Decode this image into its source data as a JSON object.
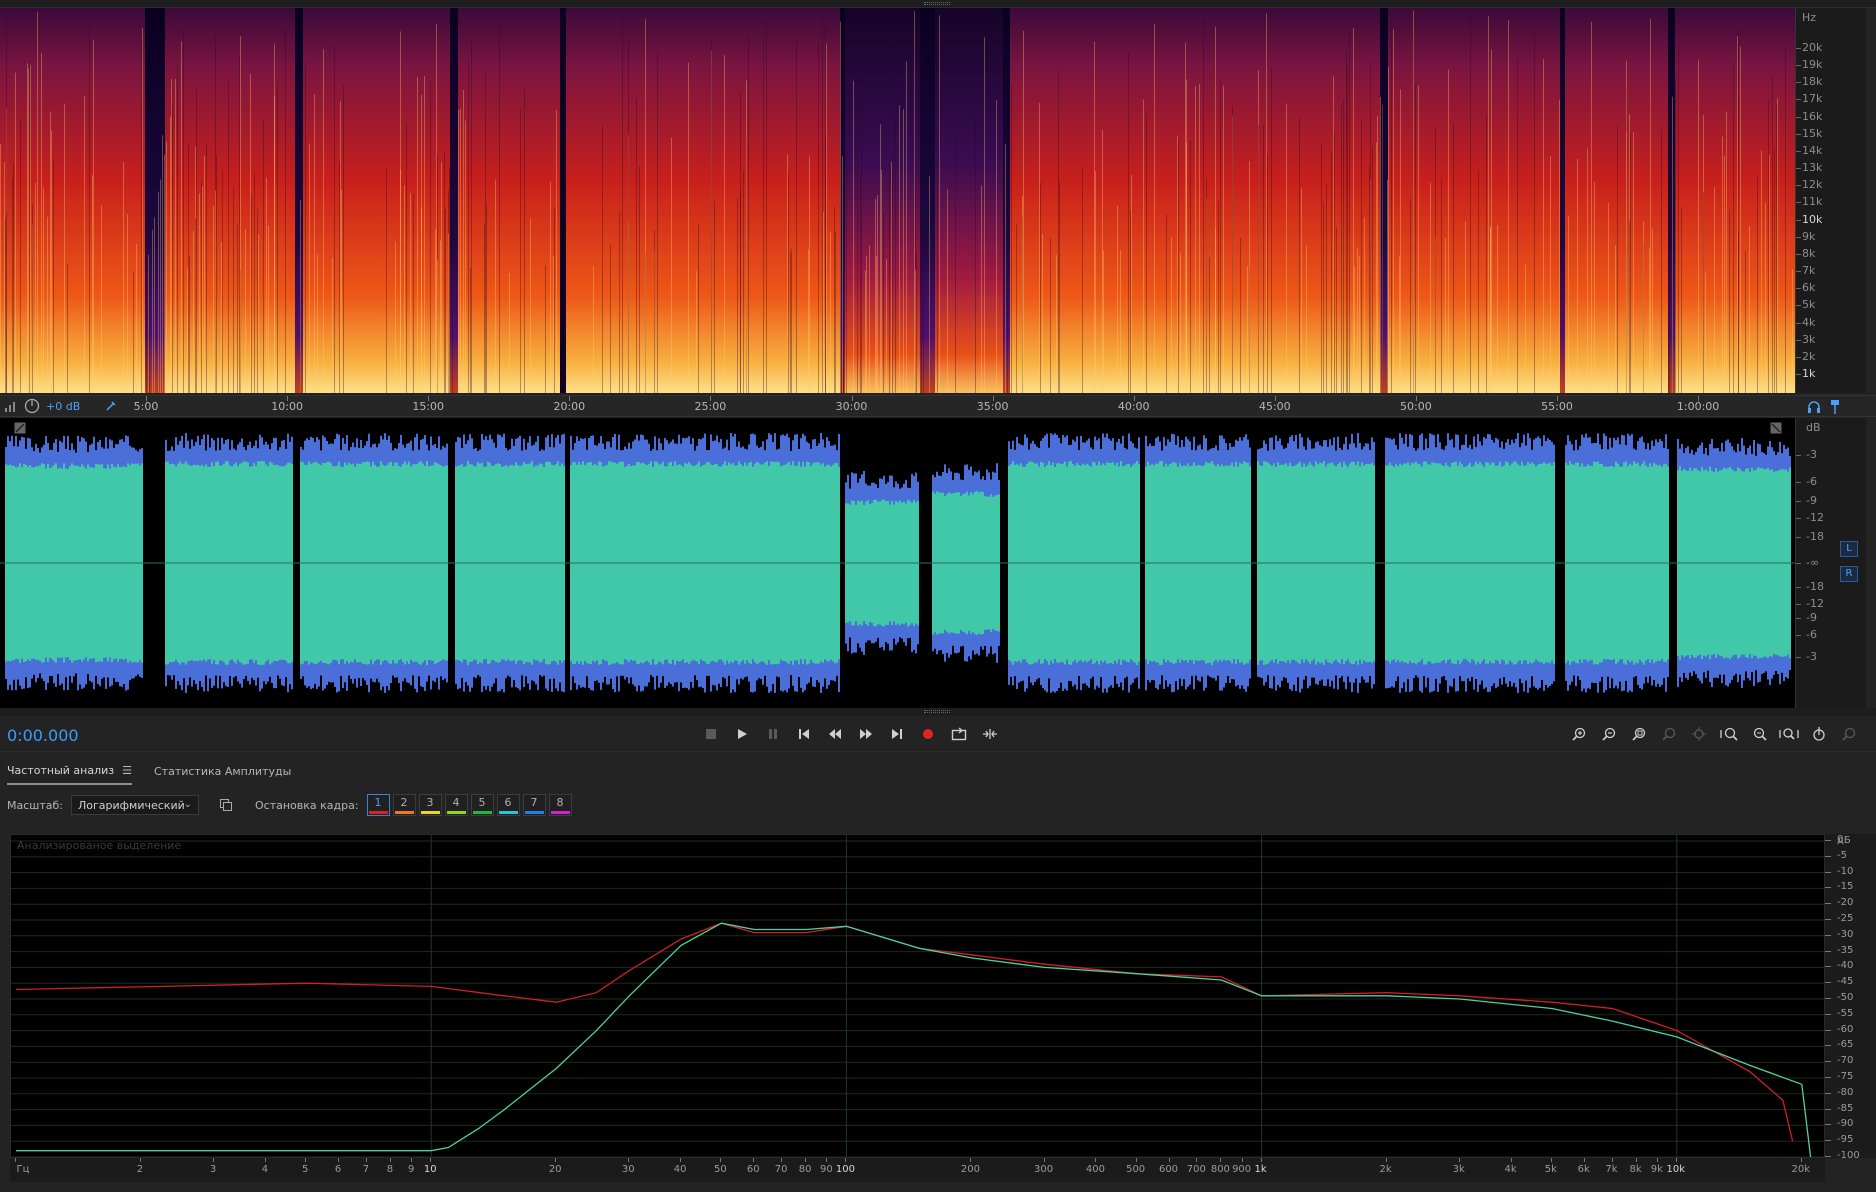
{
  "editor": {
    "spectral": {
      "unit": "Hz",
      "freq_labels": [
        "20k",
        "19k",
        "18k",
        "17k",
        "16k",
        "15k",
        "14k",
        "13k",
        "12k",
        "11k",
        "10k",
        "9k",
        "8k",
        "7k",
        "6k",
        "5k",
        "4k",
        "3k",
        "2k",
        "1k"
      ]
    },
    "timeline": {
      "gain": "+0 dB",
      "labels": [
        "5:00",
        "10:00",
        "15:00",
        "20:00",
        "25:00",
        "30:00",
        "35:00",
        "40:00",
        "45:00",
        "50:00",
        "55:00",
        "1:00:00"
      ]
    },
    "amplitude": {
      "unit": "dB",
      "labels": [
        "-3",
        "-6",
        "-9",
        "-12",
        "-18",
        "-∞",
        "-18",
        "-12",
        "-9",
        "-6",
        "-3"
      ],
      "channel_top": "L",
      "channel_bottom": "R"
    },
    "colors": {
      "waveform": "#40c8a8",
      "waveform_peaks": "#4a6fd8",
      "time_display": "#3d9bff",
      "accent": "#3f7fd0"
    }
  },
  "transport": {
    "time": "0:00.000",
    "buttons": [
      "stop",
      "play",
      "pause",
      "go-to-start",
      "rewind",
      "fast-forward",
      "go-to-end",
      "record",
      "loop",
      "skip-selection"
    ]
  },
  "panel": {
    "tabs": [
      {
        "label": "Частотный анализ",
        "active": true
      },
      {
        "label": "Статистика Амплитуды",
        "active": false
      }
    ],
    "scale_label": "Масштаб:",
    "scale_value": "Логарифмический",
    "freeze_label": "Остановка кадра:",
    "frames": [
      {
        "label": "1",
        "color": "#e02020"
      },
      {
        "label": "2",
        "color": "#f07820"
      },
      {
        "label": "3",
        "color": "#e8d820"
      },
      {
        "label": "4",
        "color": "#90d820"
      },
      {
        "label": "5",
        "color": "#20b840"
      },
      {
        "label": "6",
        "color": "#20c8d8"
      },
      {
        "label": "7",
        "color": "#2080e8"
      },
      {
        "label": "8",
        "color": "#d020d0"
      }
    ],
    "caption": "Анализированое выделение",
    "db_unit": "дБ",
    "db_labels": [
      "0",
      "-5",
      "-10",
      "-15",
      "-20",
      "-25",
      "-30",
      "-35",
      "-40",
      "-45",
      "-50",
      "-55",
      "-60",
      "-65",
      "-70",
      "-75",
      "-80",
      "-85",
      "-90",
      "-95",
      "-100"
    ],
    "freq_labels": [
      "Гц",
      "2",
      "3",
      "4",
      "5",
      "6",
      "7",
      "8",
      "9",
      "10",
      "20",
      "30",
      "40",
      "50",
      "60",
      "70",
      "80",
      "90",
      "100",
      "200",
      "300",
      "400",
      "500",
      "600",
      "700",
      "800",
      "900",
      "1k",
      "2k",
      "3k",
      "4k",
      "5k",
      "6k",
      "7k",
      "8k",
      "9k",
      "10k",
      "20k"
    ]
  },
  "chart_data": {
    "type": "line",
    "title": "",
    "xlabel": "Гц",
    "ylabel": "дБ",
    "x_scale": "log",
    "xlim": [
      1,
      22000
    ],
    "ylim": [
      -100,
      0
    ],
    "series": [
      {
        "color": "#d02020",
        "x": [
          1,
          5,
          10,
          15,
          20,
          25,
          30,
          40,
          50,
          60,
          80,
          100,
          150,
          200,
          300,
          500,
          800,
          1000,
          2000,
          3000,
          5000,
          7000,
          10000,
          15000,
          18000,
          19000
        ],
        "y": [
          -47,
          -45,
          -46,
          -49,
          -51,
          -48,
          -41,
          -31,
          -26,
          -29,
          -29,
          -27,
          -34,
          -36,
          -39,
          -42,
          -43,
          -49,
          -48,
          -49,
          -51,
          -53,
          -60,
          -73,
          -82,
          -95
        ]
      },
      {
        "color": "#50d0a0",
        "x": [
          1,
          5,
          9,
          10,
          11,
          13,
          15,
          20,
          25,
          30,
          40,
          50,
          60,
          80,
          100,
          150,
          200,
          300,
          500,
          800,
          1000,
          2000,
          3000,
          5000,
          7000,
          10000,
          15000,
          20000,
          21000
        ],
        "y": [
          -98,
          -98,
          -98,
          -98,
          -97,
          -91,
          -85,
          -72,
          -60,
          -49,
          -33,
          -26,
          -28,
          -28,
          -27,
          -34,
          -37,
          -40,
          -42,
          -44,
          -49,
          -49,
          -50,
          -53,
          -57,
          -62,
          -71,
          -77,
          -100
        ]
      }
    ]
  }
}
